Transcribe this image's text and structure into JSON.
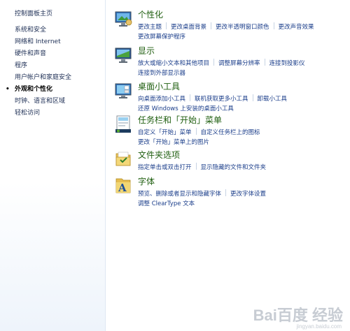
{
  "sidebar": {
    "home": "控制面板主页",
    "items": [
      {
        "label": "系统和安全"
      },
      {
        "label": "网络和 Internet"
      },
      {
        "label": "硬件和声音"
      },
      {
        "label": "程序"
      },
      {
        "label": "用户帐户和家庭安全"
      },
      {
        "label": "外观和个性化",
        "active": true
      },
      {
        "label": "时钟、语言和区域"
      },
      {
        "label": "轻松访问"
      }
    ]
  },
  "categories": [
    {
      "title": "个性化",
      "icon": "personalization-icon",
      "rows": [
        [
          "更改主题",
          "更改桌面背景",
          "更改半透明窗口颜色",
          "更改声音效果"
        ],
        [
          "更改屏幕保护程序"
        ]
      ]
    },
    {
      "title": "显示",
      "icon": "display-icon",
      "rows": [
        [
          "放大或缩小文本和其他项目",
          "调整屏幕分辨率",
          "连接到投影仪"
        ],
        [
          "连接到外部显示器"
        ]
      ]
    },
    {
      "title": "桌面小工具",
      "icon": "desktop-gadgets-icon",
      "rows": [
        [
          "向桌面添加小工具",
          "联机获取更多小工具",
          "卸载小工具"
        ],
        [
          "还原 Windows 上安装的桌面小工具"
        ]
      ]
    },
    {
      "title": "任务栏和「开始」菜单",
      "icon": "taskbar-icon",
      "rows": [
        [
          "自定义「开始」菜单",
          "自定义任务栏上的图标"
        ],
        [
          "更改「开始」菜单上的图片"
        ]
      ]
    },
    {
      "title": "文件夹选项",
      "icon": "folder-options-icon",
      "rows": [
        [
          "指定单击或双击打开",
          "显示隐藏的文件和文件夹"
        ]
      ]
    },
    {
      "title": "字体",
      "icon": "fonts-icon",
      "rows": [
        [
          "预览、删除或者显示和隐藏字体",
          "更改字体设置"
        ],
        [
          "调整 ClearType 文本"
        ]
      ]
    }
  ],
  "watermark": {
    "logo": "Bai百度 经验",
    "url": "jingyan.baidu.com"
  }
}
